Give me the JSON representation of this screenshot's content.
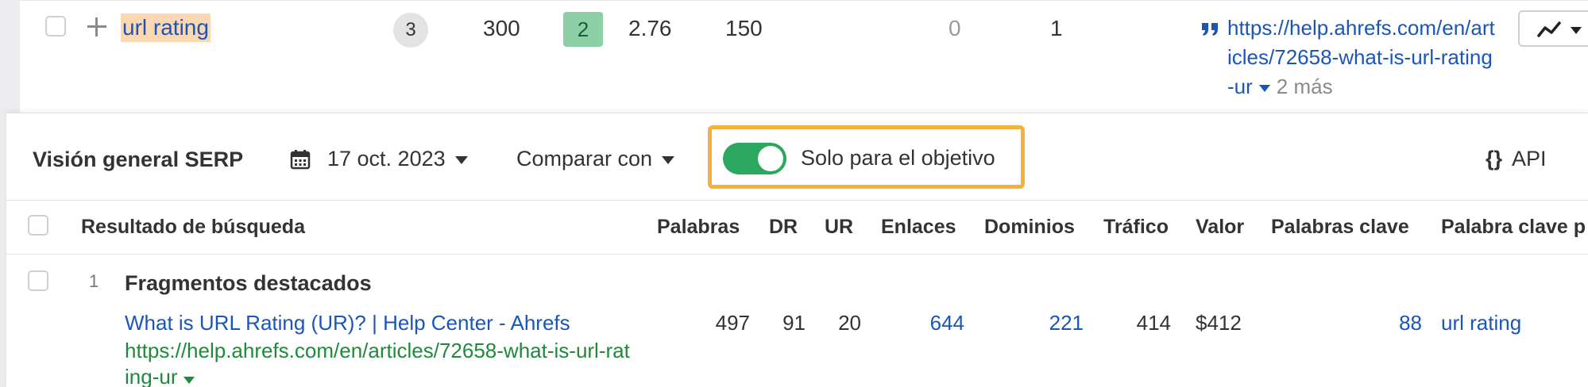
{
  "keyword_row": {
    "keyword": "url rating",
    "kd": "3",
    "volume": "300",
    "badge": "2",
    "cpc": "2.76",
    "traffic_potential": "150",
    "col_zero": "0",
    "col_one": "1",
    "url": "https://help.ahrefs.com/en/articles/72658-what-is-url-rating-ur",
    "more": "2 más",
    "icons": {
      "add": "plus-icon",
      "quote": "quote-icon",
      "trend": "trend-icon",
      "dropdown": "chevron-down-icon"
    }
  },
  "serp": {
    "title": "Visión general SERP",
    "date": "17 oct. 2023",
    "compare": "Comparar con",
    "target_only": "Solo para el objetivo",
    "target_only_on": true,
    "api": "API",
    "headers": {
      "result": "Resultado de búsqueda",
      "words": "Palabras",
      "dr": "DR",
      "ur": "UR",
      "links": "Enlaces",
      "domains": "Dominios",
      "traffic": "Tráfico",
      "value": "Valor",
      "keywords": "Palabras clave",
      "top_keyword": "Palabra clave p"
    },
    "rows": [
      {
        "num": "1",
        "section": "Fragmentos destacados",
        "title": "What is URL Rating (UR)? | Help Center - Ahrefs",
        "url": "https://help.ahrefs.com/en/articles/72658-what-is-url-rating-ur",
        "words": "497",
        "dr": "91",
        "ur": "20",
        "links": "644",
        "domains": "221",
        "traffic": "414",
        "value": "$412",
        "keywords": "88",
        "top_keyword": "url rating"
      }
    ]
  },
  "colors": {
    "link": "#1a56b8",
    "green_url": "#1f8a3a",
    "toggle_on": "#2ba760",
    "highlight_border": "#f3b23a",
    "keyword_highlight": "#fbd7b3",
    "badge_green": "#8dd0a6"
  }
}
